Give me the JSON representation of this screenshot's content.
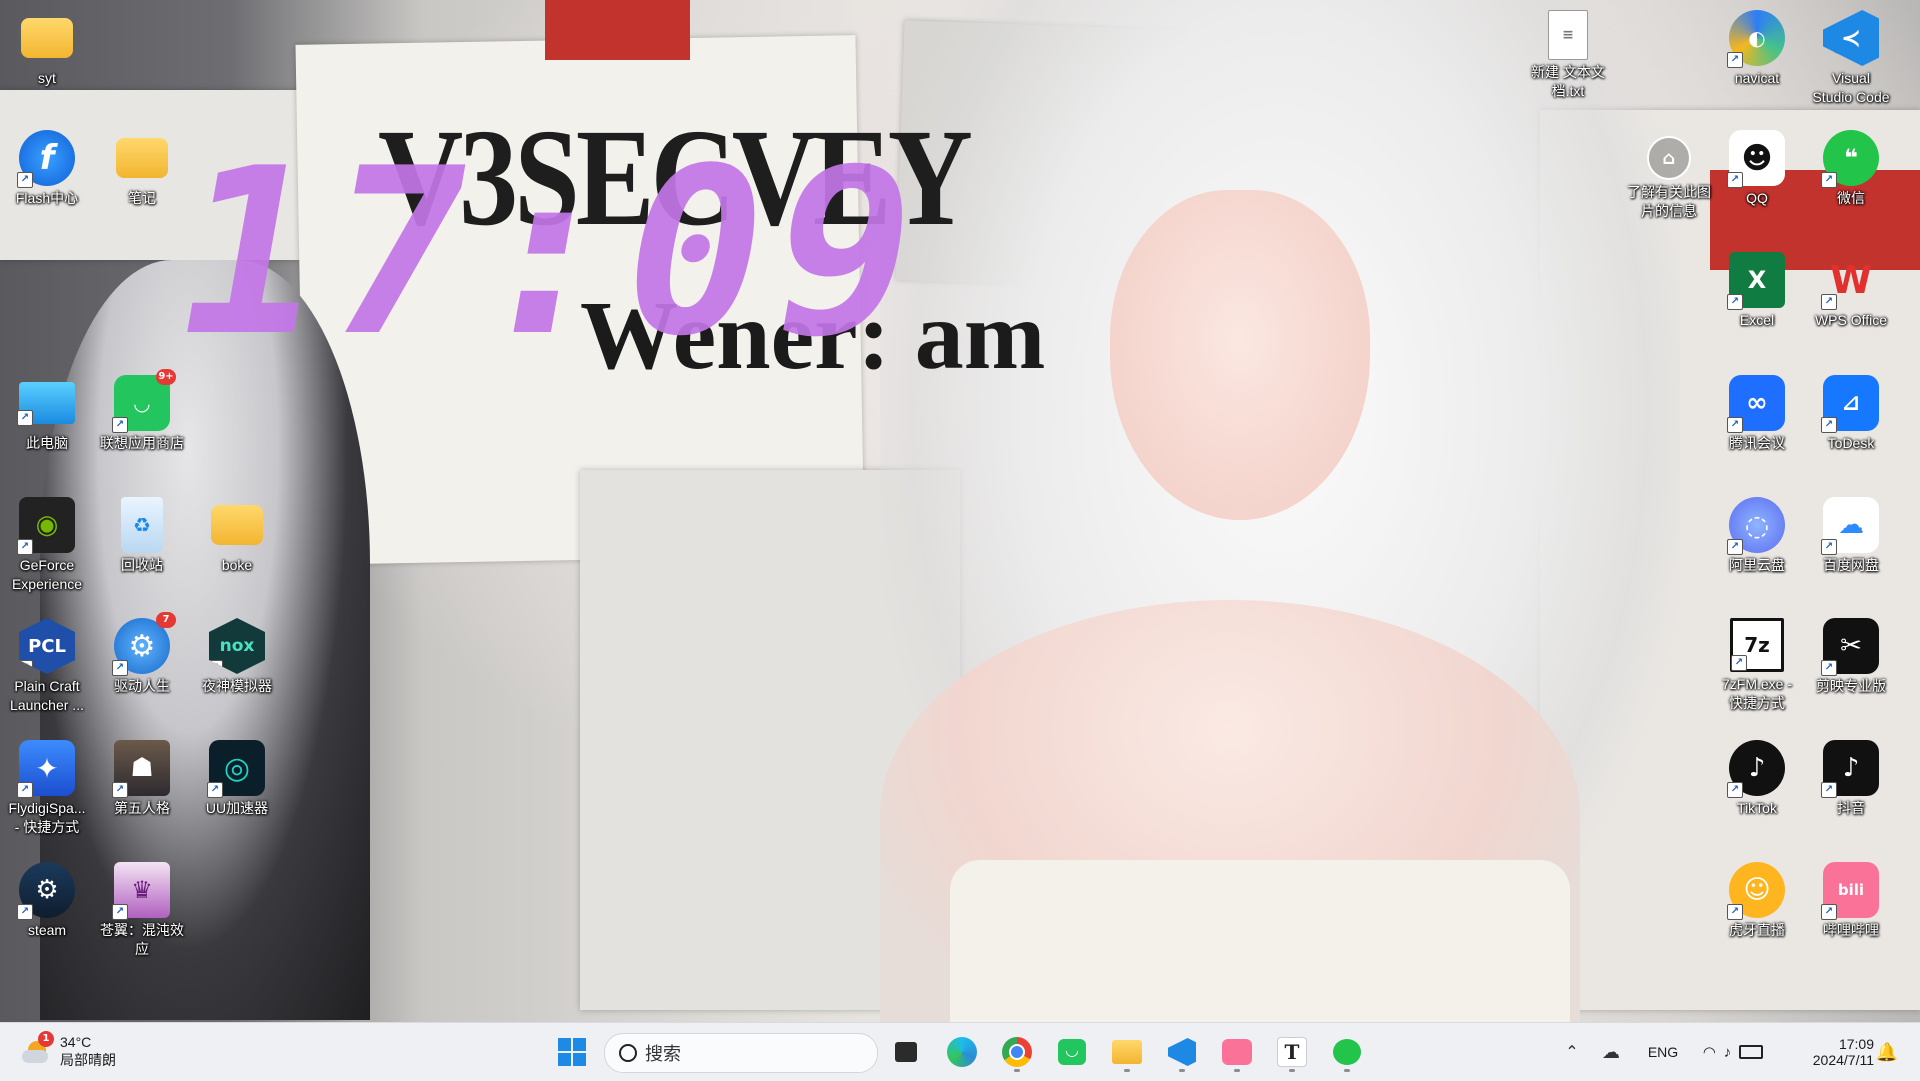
{
  "desktop": {
    "wallpaper_clock": "17:09",
    "wallpaper_headline": "V3SECVEY",
    "wallpaper_headline2": "Wener: am",
    "spotlight_label": "了解有关此图\n片的信息",
    "icons": [
      {
        "label": "syt",
        "kind": "folder"
      },
      {
        "label": "Flash中心",
        "kind": "flash"
      },
      {
        "label": "笔记",
        "kind": "folder"
      },
      {
        "label": "此电脑",
        "kind": "pc"
      },
      {
        "label": "联想应用商店",
        "kind": "store",
        "badge": "9+"
      },
      {
        "label": "GeForce\nExperience",
        "kind": "nvidia"
      },
      {
        "label": "回收站",
        "kind": "recycle"
      },
      {
        "label": "boke",
        "kind": "folder"
      },
      {
        "label": "Plain Craft\nLauncher ...",
        "kind": "pcl"
      },
      {
        "label": "驱动人生",
        "kind": "driver",
        "badge": "7"
      },
      {
        "label": "夜神模拟器",
        "kind": "nox"
      },
      {
        "label": "FlydigiSpa...\n- 快捷方式",
        "kind": "flydigi"
      },
      {
        "label": "第五人格",
        "kind": "idv"
      },
      {
        "label": "UU加速器",
        "kind": "uu"
      },
      {
        "label": "steam",
        "kind": "steam"
      },
      {
        "label": "苍翼：混沌效\n应",
        "kind": "game"
      },
      {
        "label": "新建 文本文\n档.txt",
        "kind": "txt"
      },
      {
        "label": "navicat",
        "kind": "navicat"
      },
      {
        "label": "Visual\nStudio Code",
        "kind": "vscode"
      },
      {
        "label": "QQ",
        "kind": "qq"
      },
      {
        "label": "微信",
        "kind": "wechat"
      },
      {
        "label": "Excel",
        "kind": "excel"
      },
      {
        "label": "WPS Office",
        "kind": "wps"
      },
      {
        "label": "腾讯会议",
        "kind": "meeting"
      },
      {
        "label": "ToDesk",
        "kind": "todesk"
      },
      {
        "label": "阿里云盘",
        "kind": "aliyun"
      },
      {
        "label": "百度网盘",
        "kind": "baidu"
      },
      {
        "label": "7zFM.exe -\n快捷方式",
        "kind": "7z"
      },
      {
        "label": "剪映专业版",
        "kind": "capcut"
      },
      {
        "label": "TikTok",
        "kind": "tiktok"
      },
      {
        "label": "抖音",
        "kind": "douyin"
      },
      {
        "label": "虎牙直播",
        "kind": "huya"
      },
      {
        "label": "哔哩哔哩",
        "kind": "bilibili"
      }
    ]
  },
  "taskbar": {
    "weather": {
      "temp": "34°C",
      "desc": "局部晴朗",
      "badge": "1",
      "icon": "weather-sun-cloud-icon"
    },
    "search_placeholder": "搜索",
    "apps": [
      "start",
      "task-view",
      "edge",
      "chrome",
      "lenovo-store",
      "file-explorer",
      "vscode",
      "bilibili",
      "typora",
      "wechat"
    ],
    "typora_letter": "T",
    "tray": {
      "lang": "ENG",
      "time": "17:09",
      "date": "2024/7/11"
    }
  }
}
